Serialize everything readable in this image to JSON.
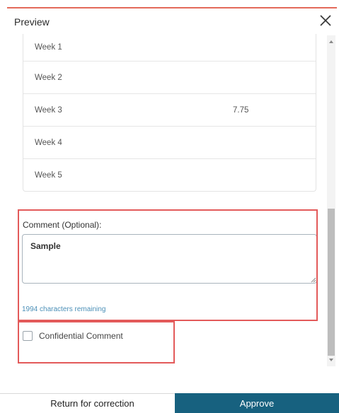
{
  "header": {
    "title": "Preview"
  },
  "weeks": [
    {
      "label": "Week 1",
      "value": ""
    },
    {
      "label": "Week 2",
      "value": ""
    },
    {
      "label": "Week 3",
      "value": "7.75"
    },
    {
      "label": "Week 4",
      "value": ""
    },
    {
      "label": "Week 5",
      "value": ""
    }
  ],
  "comment": {
    "label": "Comment (Optional):",
    "value": "Sample",
    "chars_remaining": "1994 characters remaining"
  },
  "confidential": {
    "label": "Confidential Comment",
    "checked": false
  },
  "footer": {
    "return_label": "Return for correction",
    "approve_label": "Approve"
  },
  "colors": {
    "accent": "#e36a5a",
    "highlight": "#e35a5a",
    "approve_bg": "#17617f",
    "hint_text": "#4b8fb7"
  }
}
